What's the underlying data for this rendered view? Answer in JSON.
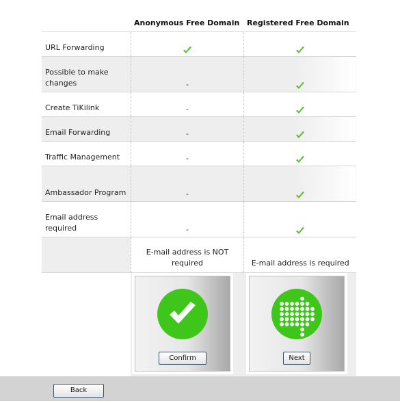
{
  "columns": {
    "feature": "",
    "anonymous": "Anonymous Free Domain",
    "registered": "Registered Free Domain"
  },
  "rows": [
    {
      "label": "URL Forwarding",
      "anonymous": "check",
      "registered": "check"
    },
    {
      "label": "Possible to make changes",
      "anonymous": "-",
      "registered": "check"
    },
    {
      "label": "Create TiKilink",
      "anonymous": "-",
      "registered": "check"
    },
    {
      "label": "Email Forwarding",
      "anonymous": "-",
      "registered": "check"
    },
    {
      "label": "Traffic Management",
      "anonymous": "-",
      "registered": "check"
    },
    {
      "label": "Ambassador Program",
      "anonymous": "-",
      "registered": "check"
    },
    {
      "label": "Email address required",
      "anonymous": "-",
      "registered": "check"
    }
  ],
  "email_requirement": {
    "anonymous": "E-mail address is NOT required",
    "registered": "E-mail address is required"
  },
  "actions": {
    "confirm_label": "Confirm",
    "next_label": "Next",
    "confirm_icon": "check-circle-icon",
    "next_icon": "arrow-dots-circle-icon"
  },
  "footer": {
    "back_label": "Back"
  },
  "colors": {
    "check_green": "#5cc236",
    "circle_green": "#3ec61a",
    "alt_row": "#eeeeee",
    "footer_bg": "#d3d3d3"
  }
}
